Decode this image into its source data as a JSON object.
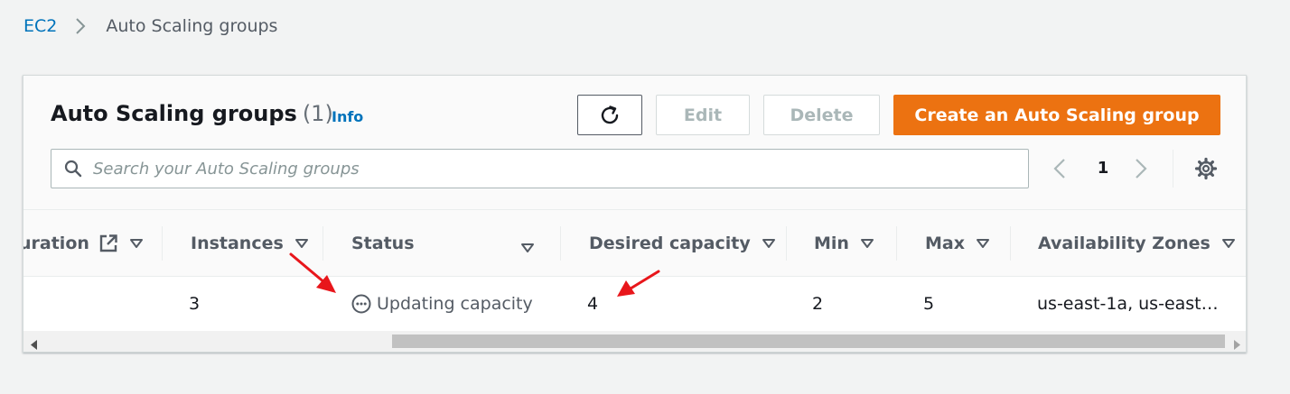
{
  "breadcrumb": {
    "root": "EC2",
    "current": "Auto Scaling groups"
  },
  "header": {
    "title": "Auto Scaling groups",
    "count": "(1)",
    "info": "Info",
    "edit_label": "Edit",
    "delete_label": "Delete",
    "create_label": "Create an Auto Scaling group"
  },
  "search": {
    "placeholder": "Search your Auto Scaling groups",
    "value": ""
  },
  "pagination": {
    "page": "1"
  },
  "table": {
    "columns": [
      "uration",
      "Instances",
      "Status",
      "Desired capacity",
      "Min",
      "Max",
      "Availability Zones"
    ],
    "rows": [
      {
        "instances": "3",
        "status": "Updating capacity",
        "desired": "4",
        "min": "2",
        "max": "5",
        "zones": "us-east-1a, us-east…"
      }
    ]
  },
  "colors": {
    "primary": "#ec7211",
    "link": "#0073bb",
    "annotation": "#e8161b"
  }
}
